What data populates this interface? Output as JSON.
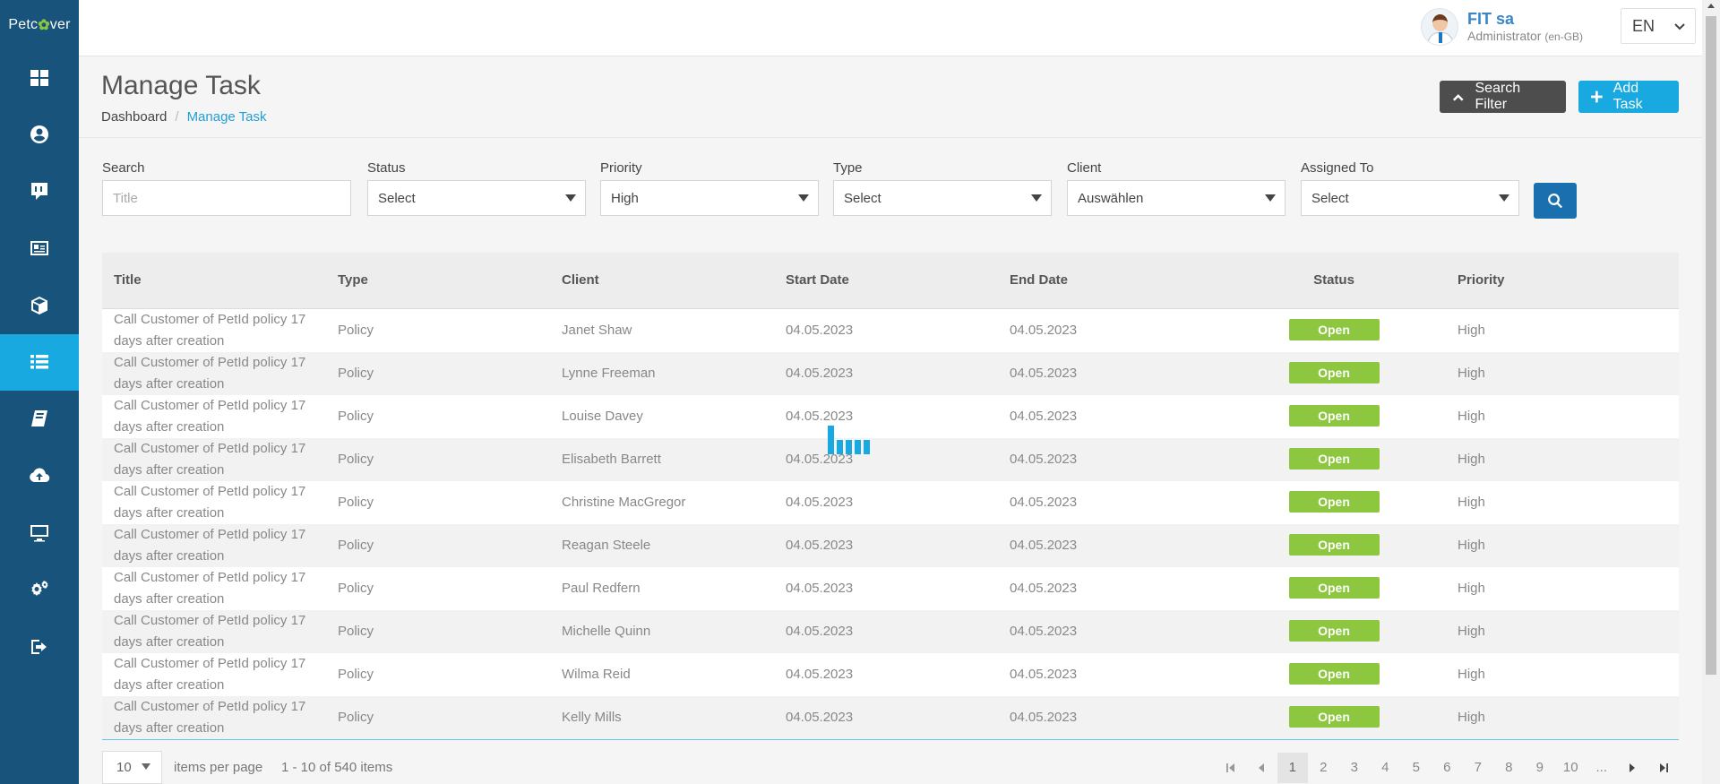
{
  "app": {
    "logo": {
      "left": "Petc",
      "mid": "✿",
      "right": "ver"
    }
  },
  "sidebar": {
    "items": [
      {
        "icon": "dashboard-icon",
        "active": false
      },
      {
        "icon": "user-icon",
        "active": false
      },
      {
        "icon": "chat-icon",
        "active": false
      },
      {
        "icon": "id-card-icon",
        "active": false
      },
      {
        "icon": "box-icon",
        "active": false
      },
      {
        "icon": "list-icon",
        "active": true
      },
      {
        "icon": "book-icon",
        "active": false
      },
      {
        "icon": "cloud-upload-icon",
        "active": false
      },
      {
        "icon": "monitor-icon",
        "active": false
      },
      {
        "icon": "gears-icon",
        "active": false
      },
      {
        "icon": "logout-icon",
        "active": false
      }
    ]
  },
  "topbar": {
    "user_name": "FIT sa",
    "user_role": "Administrator",
    "user_locale": "(en-GB)",
    "language": "EN"
  },
  "header": {
    "title": "Manage Task",
    "breadcrumb": {
      "home": "Dashboard",
      "separator": "/",
      "current": "Manage Task"
    },
    "search_filter_label": "Search Filter",
    "add_task_label": "Add Task"
  },
  "filters": {
    "search": {
      "label": "Search",
      "placeholder": "Title",
      "value": ""
    },
    "status": {
      "label": "Status",
      "value": "Select"
    },
    "priority": {
      "label": "Priority",
      "value": "High"
    },
    "type": {
      "label": "Type",
      "value": "Select"
    },
    "client": {
      "label": "Client",
      "value": "Auswählen"
    },
    "assigned_to": {
      "label": "Assigned To",
      "value": "Select"
    }
  },
  "table": {
    "columns": [
      "Title",
      "Type",
      "Client",
      "Start Date",
      "End Date",
      "Status",
      "Priority"
    ],
    "rows": [
      {
        "title": "Call Customer of PetId policy 17 days after creation",
        "type": "Policy",
        "client": "Janet Shaw",
        "start": "04.05.2023",
        "end": "04.05.2023",
        "status": "Open",
        "priority": "High"
      },
      {
        "title": "Call Customer of PetId policy 17 days after creation",
        "type": "Policy",
        "client": "Lynne Freeman",
        "start": "04.05.2023",
        "end": "04.05.2023",
        "status": "Open",
        "priority": "High"
      },
      {
        "title": "Call Customer of PetId policy 17 days after creation",
        "type": "Policy",
        "client": "Louise Davey",
        "start": "04.05.2023",
        "end": "04.05.2023",
        "status": "Open",
        "priority": "High"
      },
      {
        "title": "Call Customer of PetId policy 17 days after creation",
        "type": "Policy",
        "client": "Elisabeth Barrett",
        "start": "04.05.2023",
        "end": "04.05.2023",
        "status": "Open",
        "priority": "High"
      },
      {
        "title": "Call Customer of PetId policy 17 days after creation",
        "type": "Policy",
        "client": "Christine MacGregor",
        "start": "04.05.2023",
        "end": "04.05.2023",
        "status": "Open",
        "priority": "High"
      },
      {
        "title": "Call Customer of PetId policy 17 days after creation",
        "type": "Policy",
        "client": "Reagan Steele",
        "start": "04.05.2023",
        "end": "04.05.2023",
        "status": "Open",
        "priority": "High"
      },
      {
        "title": "Call Customer of PetId policy 17 days after creation",
        "type": "Policy",
        "client": "Paul Redfern",
        "start": "04.05.2023",
        "end": "04.05.2023",
        "status": "Open",
        "priority": "High"
      },
      {
        "title": "Call Customer of PetId policy 17 days after creation",
        "type": "Policy",
        "client": "Michelle Quinn",
        "start": "04.05.2023",
        "end": "04.05.2023",
        "status": "Open",
        "priority": "High"
      },
      {
        "title": "Call Customer of PetId policy 17 days after creation",
        "type": "Policy",
        "client": "Wilma Reid",
        "start": "04.05.2023",
        "end": "04.05.2023",
        "status": "Open",
        "priority": "High"
      },
      {
        "title": "Call Customer of PetId policy 17 days after creation",
        "type": "Policy",
        "client": "Kelly Mills",
        "start": "04.05.2023",
        "end": "04.05.2023",
        "status": "Open",
        "priority": "High"
      }
    ]
  },
  "pagination": {
    "per_page": "10",
    "per_page_label": "items per page",
    "info": "1 - 10 of 540 items",
    "pages": [
      "1",
      "2",
      "3",
      "4",
      "5",
      "6",
      "7",
      "8",
      "9",
      "10",
      "..."
    ],
    "current_page": "1"
  },
  "colors": {
    "sidebar": "#17537a",
    "accent": "#17a9e0",
    "status_open": "#8dc63f",
    "search_button": "#1a6fae"
  }
}
